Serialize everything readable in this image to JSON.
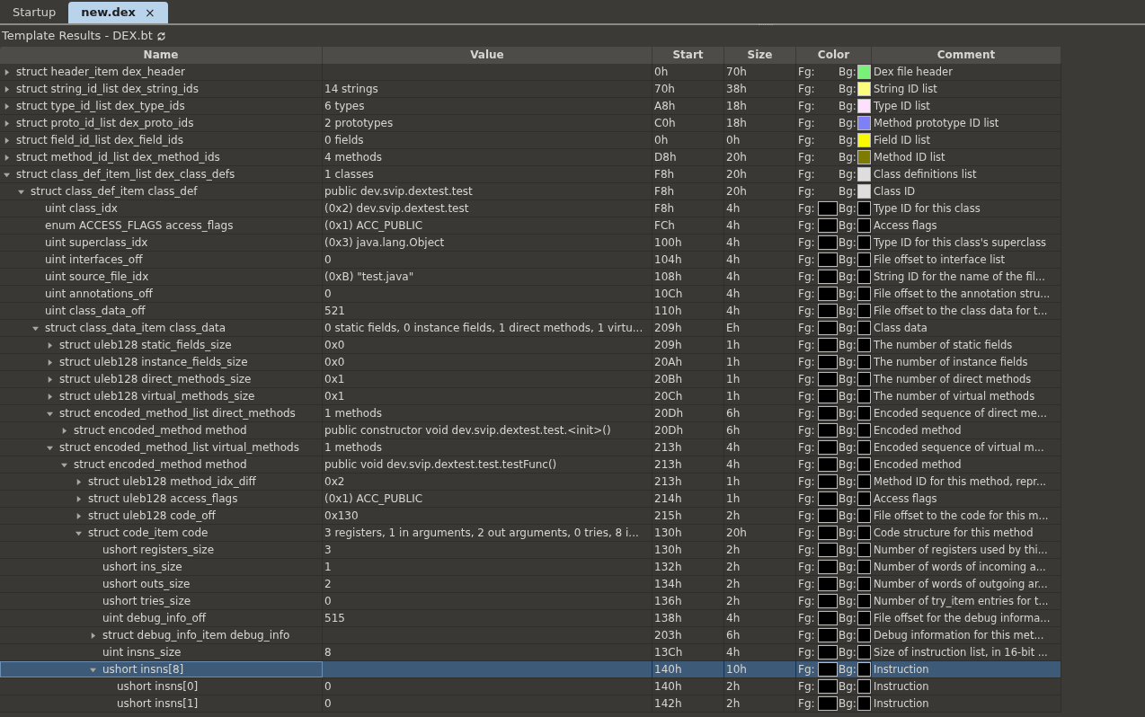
{
  "tabs": [
    {
      "label": "Startup",
      "selected": false
    },
    {
      "label": "new.dex",
      "selected": true,
      "close": "×"
    }
  ],
  "panel": {
    "title": "Template Results - DEX.bt"
  },
  "table": {
    "columns": [
      "Name",
      "Value",
      "Start",
      "Size",
      "Color",
      "Comment"
    ],
    "rows": [
      {
        "name": "struct header_item dex_header",
        "start": "0h",
        "size": "70h",
        "fg": {
          "label": "Fg:"
        },
        "bg": {
          "label": "Bg:",
          "color": "#77f177"
        },
        "comment": "Dex file header",
        "expanded": false,
        "selected": false
      },
      {
        "name": "struct string_id_list dex_string_ids",
        "value": "14 strings",
        "start": "70h",
        "size": "38h",
        "fg": {
          "label": "Fg:"
        },
        "bg": {
          "label": "Bg:",
          "color": "#fdfd7c"
        },
        "comment": "String ID list",
        "expanded": false,
        "selected": false
      },
      {
        "name": "struct type_id_list dex_type_ids",
        "value": "6 types",
        "start": "A8h",
        "size": "18h",
        "fg": {
          "label": "Fg:"
        },
        "bg": {
          "label": "Bg:",
          "color": "#fde0fb"
        },
        "comment": "Type ID list",
        "expanded": false,
        "selected": false
      },
      {
        "name": "struct proto_id_list dex_proto_ids",
        "value": "2 prototypes",
        "start": "C0h",
        "size": "18h",
        "fg": {
          "label": "Fg:"
        },
        "bg": {
          "label": "Bg:",
          "color": "#7f7ff7"
        },
        "comment": "Method prototype ID list",
        "expanded": false,
        "selected": false
      },
      {
        "name": "struct field_id_list dex_field_ids",
        "value": "0 fields",
        "start": "0h",
        "size": "0h",
        "fg": {
          "label": "Fg:"
        },
        "bg": {
          "label": "Bg:",
          "color": "#f8f800"
        },
        "comment": "Field ID list",
        "expanded": false,
        "selected": false
      },
      {
        "name": "struct method_id_list dex_method_ids",
        "value": "4 methods",
        "start": "D8h",
        "size": "20h",
        "fg": {
          "label": "Fg:"
        },
        "bg": {
          "label": "Bg:",
          "color": "#7d7b00"
        },
        "comment": "Method ID list",
        "expanded": false,
        "selected": false
      },
      {
        "name": "struct class_def_item_list dex_class_defs",
        "value": "1 classes",
        "start": "F8h",
        "size": "20h",
        "fg": {
          "label": "Fg:"
        },
        "bg": {
          "label": "Bg:",
          "color": "#dedede"
        },
        "comment": "Class definitions list",
        "expanded": true,
        "selected": false,
        "children": [
          {
            "name": "struct class_def_item class_def",
            "value": "public dev.svip.dextest.test",
            "start": "F8h",
            "size": "20h",
            "fg": {
              "label": "Fg:"
            },
            "bg": {
              "label": "Bg:",
              "color": "#dedede"
            },
            "comment": "Class ID",
            "expanded": true,
            "selected": false,
            "children": [
              {
                "name": "uint class_idx",
                "value": "(0x2) dev.svip.dextest.test",
                "start": "F8h",
                "size": "4h",
                "fg": {
                  "label": "Fg:",
                  "color": "#000000"
                },
                "bg": {
                  "label": "Bg:",
                  "color": "#000000"
                },
                "comment": "Type ID for this class",
                "selected": false
              },
              {
                "name": "enum ACCESS_FLAGS access_flags",
                "value": "(0x1) ACC_PUBLIC",
                "start": "FCh",
                "size": "4h",
                "fg": {
                  "label": "Fg:",
                  "color": "#000000"
                },
                "bg": {
                  "label": "Bg:",
                  "color": "#000000"
                },
                "comment": "Access flags",
                "selected": false
              },
              {
                "name": "uint superclass_idx",
                "value": "(0x3) java.lang.Object",
                "start": "100h",
                "size": "4h",
                "fg": {
                  "label": "Fg:",
                  "color": "#000000"
                },
                "bg": {
                  "label": "Bg:",
                  "color": "#000000"
                },
                "comment": "Type ID for this class's superclass",
                "selected": false
              },
              {
                "name": "uint interfaces_off",
                "value": "0",
                "start": "104h",
                "size": "4h",
                "fg": {
                  "label": "Fg:",
                  "color": "#000000"
                },
                "bg": {
                  "label": "Bg:",
                  "color": "#000000"
                },
                "comment": "File offset to interface list",
                "selected": false
              },
              {
                "name": "uint source_file_idx",
                "value": "(0xB) \"test.java\"",
                "start": "108h",
                "size": "4h",
                "fg": {
                  "label": "Fg:",
                  "color": "#000000"
                },
                "bg": {
                  "label": "Bg:",
                  "color": "#000000"
                },
                "comment": "String ID for the name of the fil...",
                "selected": false
              },
              {
                "name": "uint annotations_off",
                "value": "0",
                "start": "10Ch",
                "size": "4h",
                "fg": {
                  "label": "Fg:",
                  "color": "#000000"
                },
                "bg": {
                  "label": "Bg:",
                  "color": "#000000"
                },
                "comment": "File offset to the annotation stru...",
                "selected": false
              },
              {
                "name": "uint class_data_off",
                "value": "521",
                "start": "110h",
                "size": "4h",
                "fg": {
                  "label": "Fg:",
                  "color": "#000000"
                },
                "bg": {
                  "label": "Bg:",
                  "color": "#000000"
                },
                "comment": "File offset to the class data for t...",
                "selected": false
              },
              {
                "name": "struct class_data_item class_data",
                "value": "0 static fields, 0 instance fields, 1 direct methods, 1 virtu...",
                "start": "209h",
                "size": "Eh",
                "fg": {
                  "label": "Fg:",
                  "color": "#000000"
                },
                "bg": {
                  "label": "Bg:",
                  "color": "#000000"
                },
                "comment": "Class data",
                "expanded": true,
                "selected": false,
                "children": [
                  {
                    "name": "struct uleb128 static_fields_size",
                    "value": "0x0",
                    "start": "209h",
                    "size": "1h",
                    "fg": {
                      "label": "Fg:",
                      "color": "#000000"
                    },
                    "bg": {
                      "label": "Bg:",
                      "color": "#000000"
                    },
                    "comment": "The number of static fields",
                    "expanded": false,
                    "selected": false
                  },
                  {
                    "name": "struct uleb128 instance_fields_size",
                    "value": "0x0",
                    "start": "20Ah",
                    "size": "1h",
                    "fg": {
                      "label": "Fg:",
                      "color": "#000000"
                    },
                    "bg": {
                      "label": "Bg:",
                      "color": "#000000"
                    },
                    "comment": "The number of instance fields",
                    "expanded": false,
                    "selected": false
                  },
                  {
                    "name": "struct uleb128 direct_methods_size",
                    "value": "0x1",
                    "start": "20Bh",
                    "size": "1h",
                    "fg": {
                      "label": "Fg:",
                      "color": "#000000"
                    },
                    "bg": {
                      "label": "Bg:",
                      "color": "#000000"
                    },
                    "comment": "The number of direct methods",
                    "expanded": false,
                    "selected": false
                  },
                  {
                    "name": "struct uleb128 virtual_methods_size",
                    "value": "0x1",
                    "start": "20Ch",
                    "size": "1h",
                    "fg": {
                      "label": "Fg:",
                      "color": "#000000"
                    },
                    "bg": {
                      "label": "Bg:",
                      "color": "#000000"
                    },
                    "comment": "The number of virtual methods",
                    "expanded": false,
                    "selected": false
                  },
                  {
                    "name": "struct encoded_method_list direct_methods",
                    "value": "1 methods",
                    "start": "20Dh",
                    "size": "6h",
                    "fg": {
                      "label": "Fg:",
                      "color": "#000000"
                    },
                    "bg": {
                      "label": "Bg:",
                      "color": "#000000"
                    },
                    "comment": "Encoded sequence of direct me...",
                    "expanded": true,
                    "selected": false,
                    "children": [
                      {
                        "name": "struct encoded_method method",
                        "value": "public constructor void dev.svip.dextest.test.<init>()",
                        "start": "20Dh",
                        "size": "6h",
                        "fg": {
                          "label": "Fg:",
                          "color": "#000000"
                        },
                        "bg": {
                          "label": "Bg:",
                          "color": "#000000"
                        },
                        "comment": "Encoded method",
                        "expanded": false,
                        "selected": false
                      }
                    ]
                  },
                  {
                    "name": "struct encoded_method_list virtual_methods",
                    "value": "1 methods",
                    "start": "213h",
                    "size": "4h",
                    "fg": {
                      "label": "Fg:",
                      "color": "#000000"
                    },
                    "bg": {
                      "label": "Bg:",
                      "color": "#000000"
                    },
                    "comment": "Encoded sequence of virtual m...",
                    "expanded": true,
                    "selected": false,
                    "children": [
                      {
                        "name": "struct encoded_method method",
                        "value": "public void dev.svip.dextest.test.testFunc()",
                        "start": "213h",
                        "size": "4h",
                        "fg": {
                          "label": "Fg:",
                          "color": "#000000"
                        },
                        "bg": {
                          "label": "Bg:",
                          "color": "#000000"
                        },
                        "comment": "Encoded method",
                        "expanded": true,
                        "selected": false,
                        "children": [
                          {
                            "name": "struct uleb128 method_idx_diff",
                            "value": "0x2",
                            "start": "213h",
                            "size": "1h",
                            "fg": {
                              "label": "Fg:",
                              "color": "#000000"
                            },
                            "bg": {
                              "label": "Bg:",
                              "color": "#000000"
                            },
                            "comment": "Method ID for this method, repr...",
                            "expanded": false,
                            "selected": false
                          },
                          {
                            "name": "struct uleb128 access_flags",
                            "value": "(0x1) ACC_PUBLIC",
                            "start": "214h",
                            "size": "1h",
                            "fg": {
                              "label": "Fg:",
                              "color": "#000000"
                            },
                            "bg": {
                              "label": "Bg:",
                              "color": "#000000"
                            },
                            "comment": "Access flags",
                            "expanded": false,
                            "selected": false
                          },
                          {
                            "name": "struct uleb128 code_off",
                            "value": "0x130",
                            "start": "215h",
                            "size": "2h",
                            "fg": {
                              "label": "Fg:",
                              "color": "#000000"
                            },
                            "bg": {
                              "label": "Bg:",
                              "color": "#000000"
                            },
                            "comment": "File offset to the code for this m...",
                            "expanded": false,
                            "selected": false
                          },
                          {
                            "name": "struct code_item code",
                            "value": "3 registers, 1 in arguments, 2 out arguments, 0 tries, 8 i...",
                            "start": "130h",
                            "size": "20h",
                            "fg": {
                              "label": "Fg:",
                              "color": "#000000"
                            },
                            "bg": {
                              "label": "Bg:",
                              "color": "#000000"
                            },
                            "comment": "Code structure for this method",
                            "expanded": true,
                            "selected": false,
                            "children": [
                              {
                                "name": "ushort registers_size",
                                "value": "3",
                                "start": "130h",
                                "size": "2h",
                                "fg": {
                                  "label": "Fg:",
                                  "color": "#000000"
                                },
                                "bg": {
                                  "label": "Bg:",
                                  "color": "#000000"
                                },
                                "comment": "Number of registers used by thi...",
                                "selected": false
                              },
                              {
                                "name": "ushort ins_size",
                                "value": "1",
                                "start": "132h",
                                "size": "2h",
                                "fg": {
                                  "label": "Fg:",
                                  "color": "#000000"
                                },
                                "bg": {
                                  "label": "Bg:",
                                  "color": "#000000"
                                },
                                "comment": "Number of words of incoming a...",
                                "selected": false
                              },
                              {
                                "name": "ushort outs_size",
                                "value": "2",
                                "start": "134h",
                                "size": "2h",
                                "fg": {
                                  "label": "Fg:",
                                  "color": "#000000"
                                },
                                "bg": {
                                  "label": "Bg:",
                                  "color": "#000000"
                                },
                                "comment": "Number of words of outgoing ar...",
                                "selected": false
                              },
                              {
                                "name": "ushort tries_size",
                                "value": "0",
                                "start": "136h",
                                "size": "2h",
                                "fg": {
                                  "label": "Fg:",
                                  "color": "#000000"
                                },
                                "bg": {
                                  "label": "Bg:",
                                  "color": "#000000"
                                },
                                "comment": "Number of try_item entries for t...",
                                "selected": false
                              },
                              {
                                "name": "uint debug_info_off",
                                "value": "515",
                                "start": "138h",
                                "size": "4h",
                                "fg": {
                                  "label": "Fg:",
                                  "color": "#000000"
                                },
                                "bg": {
                                  "label": "Bg:",
                                  "color": "#000000"
                                },
                                "comment": "File offset for the debug informa...",
                                "selected": false
                              },
                              {
                                "name": "struct debug_info_item debug_info",
                                "start": "203h",
                                "size": "6h",
                                "fg": {
                                  "label": "Fg:",
                                  "color": "#000000"
                                },
                                "bg": {
                                  "label": "Bg:",
                                  "color": "#000000"
                                },
                                "comment": "Debug information for this met...",
                                "expanded": false,
                                "selected": false
                              },
                              {
                                "name": "uint insns_size",
                                "value": "8",
                                "start": "13Ch",
                                "size": "4h",
                                "fg": {
                                  "label": "Fg:",
                                  "color": "#000000"
                                },
                                "bg": {
                                  "label": "Bg:",
                                  "color": "#000000"
                                },
                                "comment": "Size of instruction list, in 16-bit ...",
                                "selected": false
                              },
                              {
                                "name": "ushort insns[8]",
                                "start": "140h",
                                "size": "10h",
                                "fg": {
                                  "label": "Fg:",
                                  "color": "#000000"
                                },
                                "bg": {
                                  "label": "Bg:",
                                  "color": "#000000"
                                },
                                "comment": "Instruction",
                                "expanded": true,
                                "selected": true,
                                "children": [
                                  {
                                    "name": "ushort insns[0]",
                                    "value": "0",
                                    "start": "140h",
                                    "size": "2h",
                                    "fg": {
                                      "label": "Fg:",
                                      "color": "#000000"
                                    },
                                    "bg": {
                                      "label": "Bg:",
                                      "color": "#000000"
                                    },
                                    "comment": "Instruction",
                                    "selected": false
                                  },
                                  {
                                    "name": "ushort insns[1]",
                                    "value": "0",
                                    "start": "142h",
                                    "size": "2h",
                                    "fg": {
                                      "label": "Fg:",
                                      "color": "#000000"
                                    },
                                    "bg": {
                                      "label": "Bg:",
                                      "color": "#000000"
                                    },
                                    "comment": "Instruction",
                                    "selected": false
                                  }
                                ]
                              }
                            ]
                          }
                        ]
                      }
                    ]
                  }
                ]
              }
            ]
          }
        ]
      }
    ]
  }
}
